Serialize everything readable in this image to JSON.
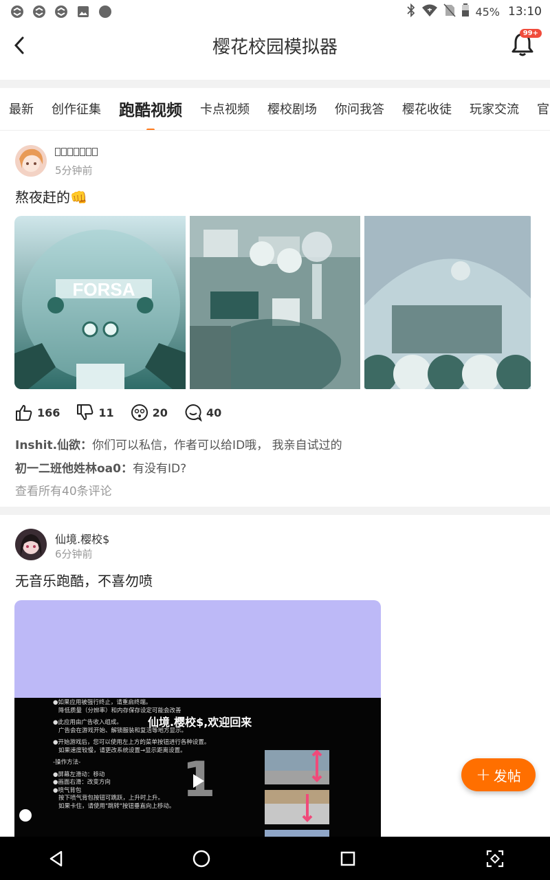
{
  "status": {
    "battery": "45%",
    "time": "13:10"
  },
  "header": {
    "title": "樱花校园模拟器",
    "badge": "99+"
  },
  "tabs": [
    {
      "label": "最新"
    },
    {
      "label": "创作征集"
    },
    {
      "label": "跑酷视频",
      "active": true
    },
    {
      "label": "卡点视频"
    },
    {
      "label": "樱校剧场"
    },
    {
      "label": "你问我答"
    },
    {
      "label": "樱花收徒"
    },
    {
      "label": "玩家交流"
    },
    {
      "label": "官"
    }
  ],
  "post1": {
    "time": "5分钟前",
    "text": "熬夜赶的👊",
    "likes": "166",
    "dislikes": "11",
    "emoji_count": "20",
    "comments": "40",
    "comment1_user": "Inshit.仙欲：",
    "comment1_text": "你们可以私信，作者可以给ID哦， 我亲自试过的",
    "comment2_user": "初一二班他姓林oa0：",
    "comment2_text": "有没有ID?",
    "view_all": "查看所有40条评论",
    "image1_text": "FORSA"
  },
  "post2": {
    "user": "仙境.樱校$",
    "time": "6分钟前",
    "text": "无音乐跑酷，不喜勿喷",
    "video_heading": "仙境.樱校$,欢迎回来",
    "video_lines": [
      "●如果应用被强行终止，请重启终端。",
      "降低质量（分辨率）和内存保存设定可能会改善",
      "●此应用由广告收入组成。",
      "广告会在游戏开始、解锁服装和复活等地方显示。",
      "●开始游戏后，您可以使用左上方的菜单按钮进行各种设置。",
      "如果速度较慢，请更改系统设置→显示距离设置。",
      "-操作方法-",
      "●屏幕左滑动：移动",
      "●画面右滑：改变方向",
      "●喷气背包",
      "按下喷气背包按钮可跳跃，上升时上升。",
      "如果卡住，请使用\"跳转\"按钮垂直向上移动。"
    ],
    "video_number": "1"
  },
  "fab": {
    "label": "发帖"
  },
  "colors": {
    "accent": "#ff6f00",
    "badge": "#f04c3c",
    "video_bg": "#bdb9f7"
  }
}
